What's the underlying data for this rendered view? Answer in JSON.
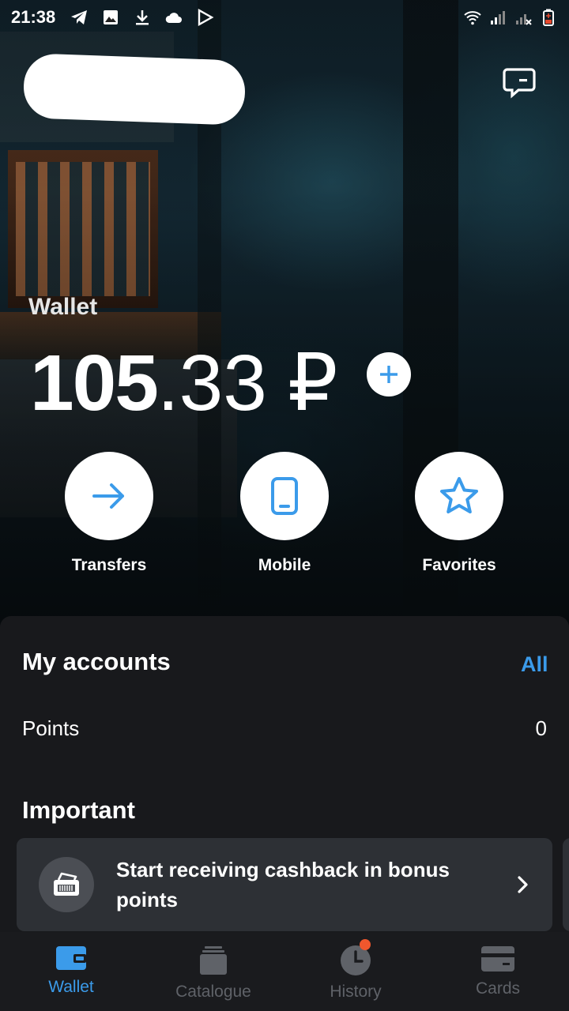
{
  "status_bar": {
    "time": "21:38",
    "left_icons": [
      "telegram-icon",
      "image-icon",
      "download-icon",
      "cloud-icon",
      "play-store-icon"
    ],
    "right_icons": [
      "wifi-icon",
      "signal-icon",
      "signal-x-icon",
      "battery-low-icon"
    ]
  },
  "header": {
    "name_redacted": true,
    "chat_icon": "chat-icon"
  },
  "wallet": {
    "label": "Wallet",
    "balance_int": "105",
    "balance_frac": ".33",
    "currency": "₽",
    "add_icon": "plus-icon"
  },
  "actions": [
    {
      "label": "Transfers",
      "icon": "arrow-right-icon"
    },
    {
      "label": "Mobile",
      "icon": "phone-icon"
    },
    {
      "label": "Favorites",
      "icon": "star-icon"
    }
  ],
  "accounts": {
    "title": "My accounts",
    "all_label": "All",
    "rows": [
      {
        "name": "Points",
        "value": "0"
      }
    ]
  },
  "important": {
    "title": "Important",
    "promo_text": "Start receiving cashback in bonus points",
    "promo_icon": "card-reader-icon"
  },
  "nav": {
    "items": [
      {
        "label": "Wallet",
        "icon": "wallet-icon",
        "active": true
      },
      {
        "label": "Catalogue",
        "icon": "catalogue-icon",
        "active": false
      },
      {
        "label": "History",
        "icon": "clock-icon",
        "active": false,
        "badge": true
      },
      {
        "label": "Cards",
        "icon": "card-icon",
        "active": false
      }
    ]
  },
  "colors": {
    "accent": "#3b9bea",
    "badge": "#f0572d",
    "sheet_bg": "#18191c",
    "card_bg": "#2d3035",
    "nav_inactive": "#5f6268"
  }
}
